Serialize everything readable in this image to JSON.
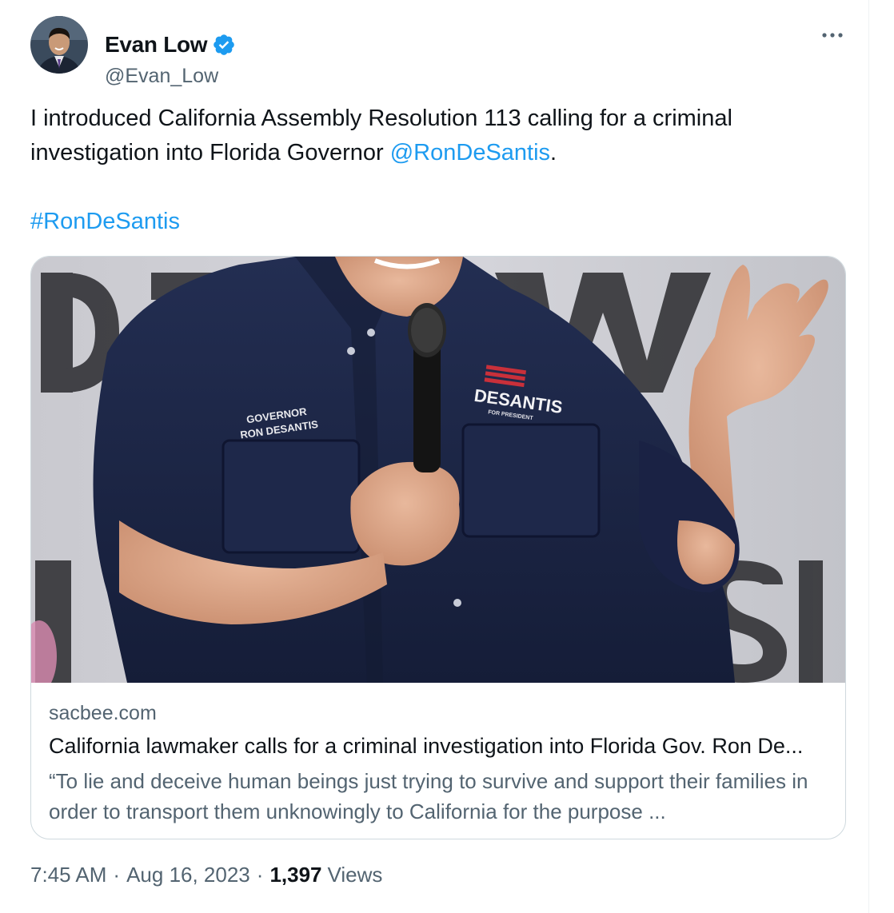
{
  "author": {
    "display_name": "Evan Low",
    "handle": "@Evan_Low",
    "verified_icon": "verified-badge-icon",
    "avatar_icon": "avatar-photo"
  },
  "more_icon": "more-options-icon",
  "tweet": {
    "text_before": "I introduced California Assembly Resolution 113 calling for a criminal investigation into Florida Governor ",
    "mention": "@RonDeSantis",
    "text_after": ".",
    "hashtag": "#RonDeSantis"
  },
  "card": {
    "domain": "sacbee.com",
    "title": "California lawmaker calls for a criminal investigation into Florida Gov. Ron De...",
    "description": "“To lie and deceive human beings just trying to survive and support their families in order to transport them unknowingly to California for the purpose ...",
    "image": {
      "backdrop_letters_top": "D T   WALL",
      "backdrop_letters_bottom": "ASIO",
      "shirt_left_line1": "GOVERNOR",
      "shirt_left_line2": "RON DESANTIS",
      "shirt_right_logo": "DESANTIS",
      "shirt_right_sub": "FOR PRESIDENT"
    }
  },
  "meta": {
    "time": "7:45 AM",
    "separator": "·",
    "date": "Aug 16, 2023",
    "views_count": "1,397",
    "views_label": "Views"
  },
  "colors": {
    "link": "#1d9bf0",
    "secondary_text": "#536471",
    "primary_text": "#0f1419",
    "border": "#cfd9de",
    "shirt_navy": "#1c2747"
  }
}
